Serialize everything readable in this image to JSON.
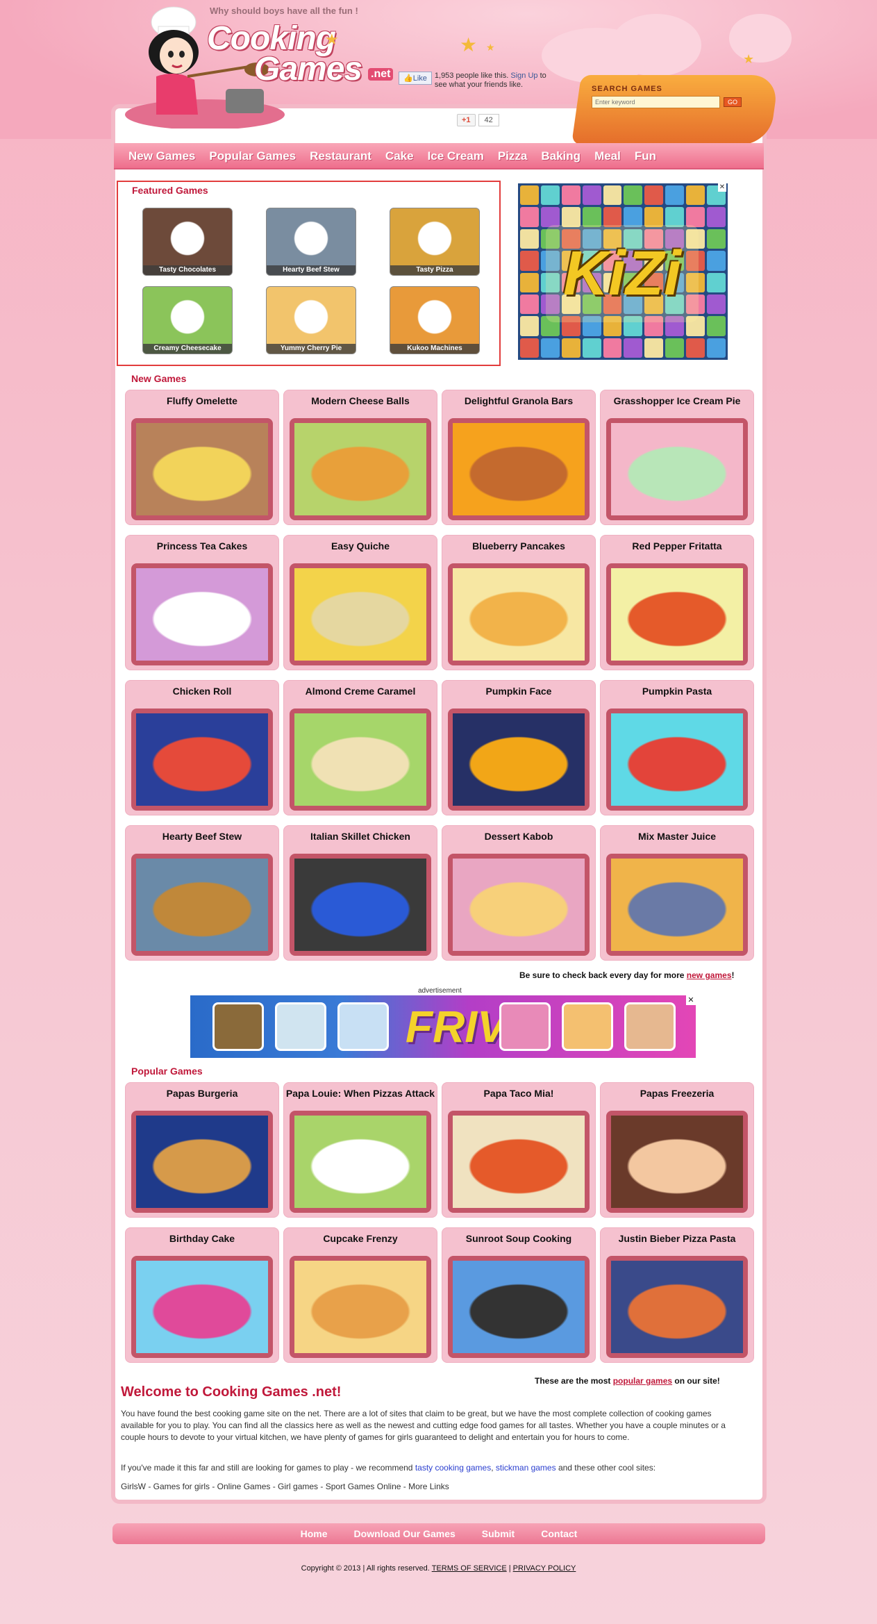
{
  "header": {
    "tagline": "Why should boys have all the fun !",
    "logo_line1": "Cooking",
    "logo_line2": "Games",
    "logo_tld": ".net"
  },
  "facebook": {
    "like_label": "Like",
    "count_text": "1,953 people like this.",
    "signup_link": "Sign Up",
    "signup_rest": "to see what your friends like."
  },
  "search": {
    "label": "SEARCH GAMES",
    "placeholder": "Enter keyword",
    "go_label": "GO"
  },
  "gplus": {
    "button": "+1",
    "count": "42"
  },
  "nav": [
    "New Games",
    "Popular Games",
    "Restaurant",
    "Cake",
    "Ice Cream",
    "Pizza",
    "Baking",
    "Meal",
    "Fun"
  ],
  "featured": {
    "title": "Featured Games",
    "items": [
      {
        "label": "Tasty Chocolates",
        "color": "#6d4a3a"
      },
      {
        "label": "Hearty Beef Stew",
        "color": "#7a8da0"
      },
      {
        "label": "Tasty Pizza",
        "color": "#d9a33c"
      },
      {
        "label": "Creamy Cheesecake",
        "color": "#8bc45a"
      },
      {
        "label": "Yummy Cherry Pie",
        "color": "#f2c46c"
      },
      {
        "label": "Kukoo Machines",
        "color": "#e89a3a"
      }
    ]
  },
  "kizi": {
    "logo": "KiZi",
    "close": "✕"
  },
  "new_games": {
    "title": "New Games",
    "items": [
      {
        "title": "Fluffy Omelette",
        "bg": "#b8825a",
        "fg": "#f2d35a"
      },
      {
        "title": "Modern Cheese Balls",
        "bg": "#b7d36b",
        "fg": "#e8a03a"
      },
      {
        "title": "Delightful Granola Bars",
        "bg": "#f6a21d",
        "fg": "#c46a2e"
      },
      {
        "title": "Grasshopper Ice Cream Pie",
        "bg": "#f4b7c9",
        "fg": "#b8e6b8"
      },
      {
        "title": "Princess Tea Cakes",
        "bg": "#d49ad8",
        "fg": "#ffffff"
      },
      {
        "title": "Easy Quiche",
        "bg": "#f3d34a",
        "fg": "#e5d7a0"
      },
      {
        "title": "Blueberry Pancakes",
        "bg": "#f7e7a3",
        "fg": "#f2b34a"
      },
      {
        "title": "Red Pepper Fritatta",
        "bg": "#f3f0a5",
        "fg": "#e55a2a"
      },
      {
        "title": "Chicken Roll",
        "bg": "#2a3f9a",
        "fg": "#e54a3a"
      },
      {
        "title": "Almond Creme Caramel",
        "bg": "#a6d66a",
        "fg": "#f0e1b4"
      },
      {
        "title": "Pumpkin Face",
        "bg": "#263066",
        "fg": "#f2a617"
      },
      {
        "title": "Pumpkin Pasta",
        "bg": "#5fd9e6",
        "fg": "#e3443a"
      },
      {
        "title": "Hearty Beef Stew",
        "bg": "#6a8aa8",
        "fg": "#c0883a"
      },
      {
        "title": "Italian Skillet Chicken",
        "bg": "#3a3a3a",
        "fg": "#2a5ad6"
      },
      {
        "title": "Dessert Kabob",
        "bg": "#e9a6c2",
        "fg": "#f7d07a"
      },
      {
        "title": "Mix Master Juice",
        "bg": "#f0b44a",
        "fg": "#6a7aa6"
      }
    ]
  },
  "check_back": {
    "pre": "Be sure to check back every day for more",
    "link": "new games",
    "post": "!"
  },
  "advertisement": {
    "label": "advertisement",
    "logo": "FRIV",
    "close": "✕"
  },
  "popular_games": {
    "title": "Popular Games",
    "items": [
      {
        "title": "Papas Burgeria",
        "bg": "#1f3a8a",
        "fg": "#d69a4a"
      },
      {
        "title": "Papa Louie: When Pizzas Attack",
        "bg": "#a9d46a",
        "fg": "#ffffff"
      },
      {
        "title": "Papa Taco Mia!",
        "bg": "#f0e2c0",
        "fg": "#e55a2a"
      },
      {
        "title": "Papas Freezeria",
        "bg": "#6a3a2a",
        "fg": "#f3c7a0"
      },
      {
        "title": "Birthday Cake",
        "bg": "#7ad0f0",
        "fg": "#e04a9a"
      },
      {
        "title": "Cupcake Frenzy",
        "bg": "#f6d585",
        "fg": "#e8a14a"
      },
      {
        "title": "Sunroot Soup Cooking",
        "bg": "#5a9ae0",
        "fg": "#333333"
      },
      {
        "title": "Justin Bieber Pizza Pasta",
        "bg": "#3a4a8a",
        "fg": "#e0703a"
      }
    ]
  },
  "popular_note": {
    "pre": "These are the most",
    "link": "popular games",
    "post": "on our site!"
  },
  "welcome": {
    "title": "Welcome to Cooking Games .net!",
    "p1": "You have found the best cooking game site on the net. There are a lot of sites that claim to be great, but we have the most complete collection of cooking games available for you to play. You can find all the classics here as well as the newest and cutting edge food games for all tastes. Whether you have a couple minutes or a couple hours to devote to your virtual kitchen, we have plenty of games for girls guaranteed to delight and entertain you for hours to come.",
    "p2_pre": "If you've made it this far and still are looking for games to play - we recommend",
    "p2_link1": "tasty cooking games",
    "p2_sep": ",",
    "p2_link2": "stickman games",
    "p2_post": "and these other cool sites:",
    "links": "GirlsW - Games for girls - Online Games - Girl games - Sport Games Online - More Links"
  },
  "footer": {
    "nav": [
      "Home",
      "Download Our Games",
      "Submit",
      "Contact"
    ],
    "copyright": "Copyright © 2013 | All rights reserved.",
    "terms": "TERMS OF SERVICE",
    "sep": "|",
    "privacy": "PRIVACY POLICY"
  }
}
